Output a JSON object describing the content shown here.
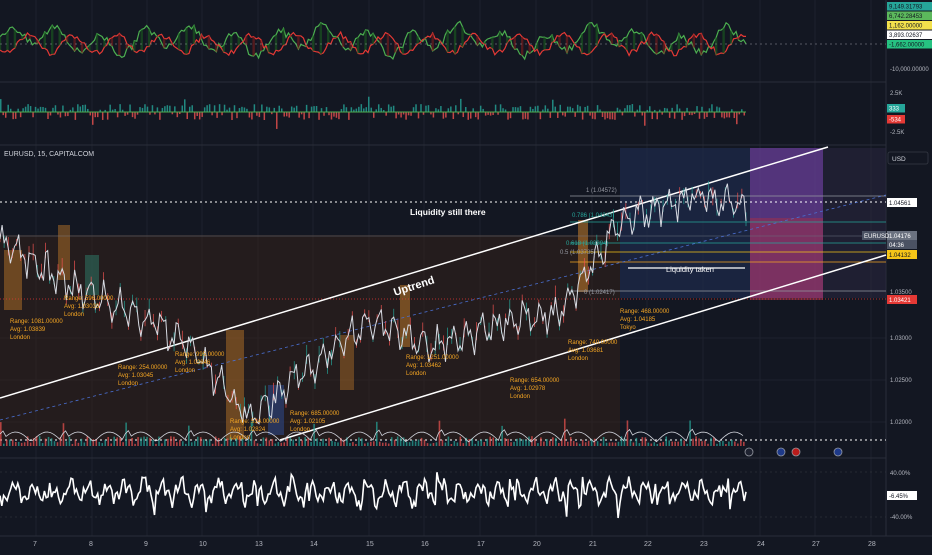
{
  "symbol": "EURUSD, 15, CAPITALCOM",
  "currency": "USD",
  "osc1": {
    "badges": [
      {
        "text": "9,149.31793",
        "color": "#26a69a"
      },
      {
        "text": "6,742.28453",
        "color": "#5cb85c"
      },
      {
        "text": "1,162.00000",
        "color": "#f3e14c"
      },
      {
        "text": "3,893.02637",
        "color": "#ffffff"
      },
      {
        "text": "-1,662.00000",
        "color": "#26c281"
      }
    ],
    "neg_label": "-10,000.00000"
  },
  "osc2": {
    "top_label": "2.5K",
    "badge_pos": "333",
    "badge_neg": "-534",
    "bottom_label": "-2.5K"
  },
  "osc3": {
    "top_label": "40.00%",
    "badge": "-6.45%",
    "bottom_label": "-40.00%"
  },
  "price_axis": {
    "ticks": [
      "1.03500",
      "1.03000",
      "1.02500",
      "1.02000"
    ],
    "price_badges": [
      {
        "text": "1.04561",
        "color": "#ffffff",
        "fg": "#131722"
      },
      {
        "text": "1.04176",
        "color": "#6b7280",
        "fg": "#ffffff"
      },
      {
        "text": "04:36",
        "color": "#4b5263",
        "fg": "#ffffff"
      },
      {
        "text": "1.04132",
        "color": "#f5c518",
        "fg": "#131722"
      },
      {
        "text": "1.03421",
        "color": "#e53935",
        "fg": "#ffffff"
      }
    ],
    "tag": "EURUSD"
  },
  "annotations": {
    "uptrend": "Uptrend",
    "liquidity_still_there": "Liquidity still there",
    "liquidity_taken": "Liquidity taken"
  },
  "fib_labels": [
    "1 (1.04572)",
    "0.786 (1.04343)",
    "0.618 (1.03894)",
    "0.5 (1.03735)",
    "0 (1.02417)"
  ],
  "sessions": [
    {
      "range": "Range: 1081.00000",
      "avg": "Avg: 1.03839",
      "name": "London"
    },
    {
      "range": "Range: 596.00000",
      "avg": "Avg: 1.03033",
      "name": "London"
    },
    {
      "range": "Range: 254.00000",
      "avg": "Avg: 1.03045",
      "name": "London"
    },
    {
      "range": "Range: 995.00000",
      "avg": "Avg: 1.02846",
      "name": "London"
    },
    {
      "range": "Range: 514.00000",
      "avg": "Avg: 1.02824",
      "name": "London"
    },
    {
      "range": "Range: 685.00000",
      "avg": "Avg: 1.02105",
      "name": "London"
    },
    {
      "range": "Range: 1251.00000",
      "avg": "Avg: 1.03462",
      "name": "London"
    },
    {
      "range": "Range: 654.00000",
      "avg": "Avg: 1.02978",
      "name": "London"
    },
    {
      "range": "Range: 740.00000",
      "avg": "Avg: 1.03681",
      "name": "London"
    },
    {
      "range": "Range: 468.00000",
      "avg": "Avg: 1.04185",
      "name": "Tokyo"
    }
  ],
  "x_axis": [
    "7",
    "8",
    "9",
    "10",
    "13",
    "14",
    "15",
    "16",
    "17",
    "20",
    "21",
    "22",
    "23",
    "24",
    "27",
    "28"
  ],
  "chart_data": {
    "type": "line",
    "symbol": "EURUSD",
    "interval": "15",
    "x": [
      "7",
      "8",
      "9",
      "10",
      "13",
      "14",
      "15",
      "16",
      "17",
      "20",
      "21",
      "22",
      "23"
    ],
    "series": [
      {
        "values": [
          1.038,
          1.0335,
          1.0305,
          1.027,
          1.019,
          1.0245,
          1.029,
          1.0265,
          1.029,
          1.03,
          1.04,
          1.0425,
          1.0418
        ]
      }
    ],
    "ylim": [
      1.0165,
      1.0475
    ],
    "price_levels": [
      1.04561,
      1.04176,
      1.04132,
      1.03421
    ],
    "grid": true
  }
}
